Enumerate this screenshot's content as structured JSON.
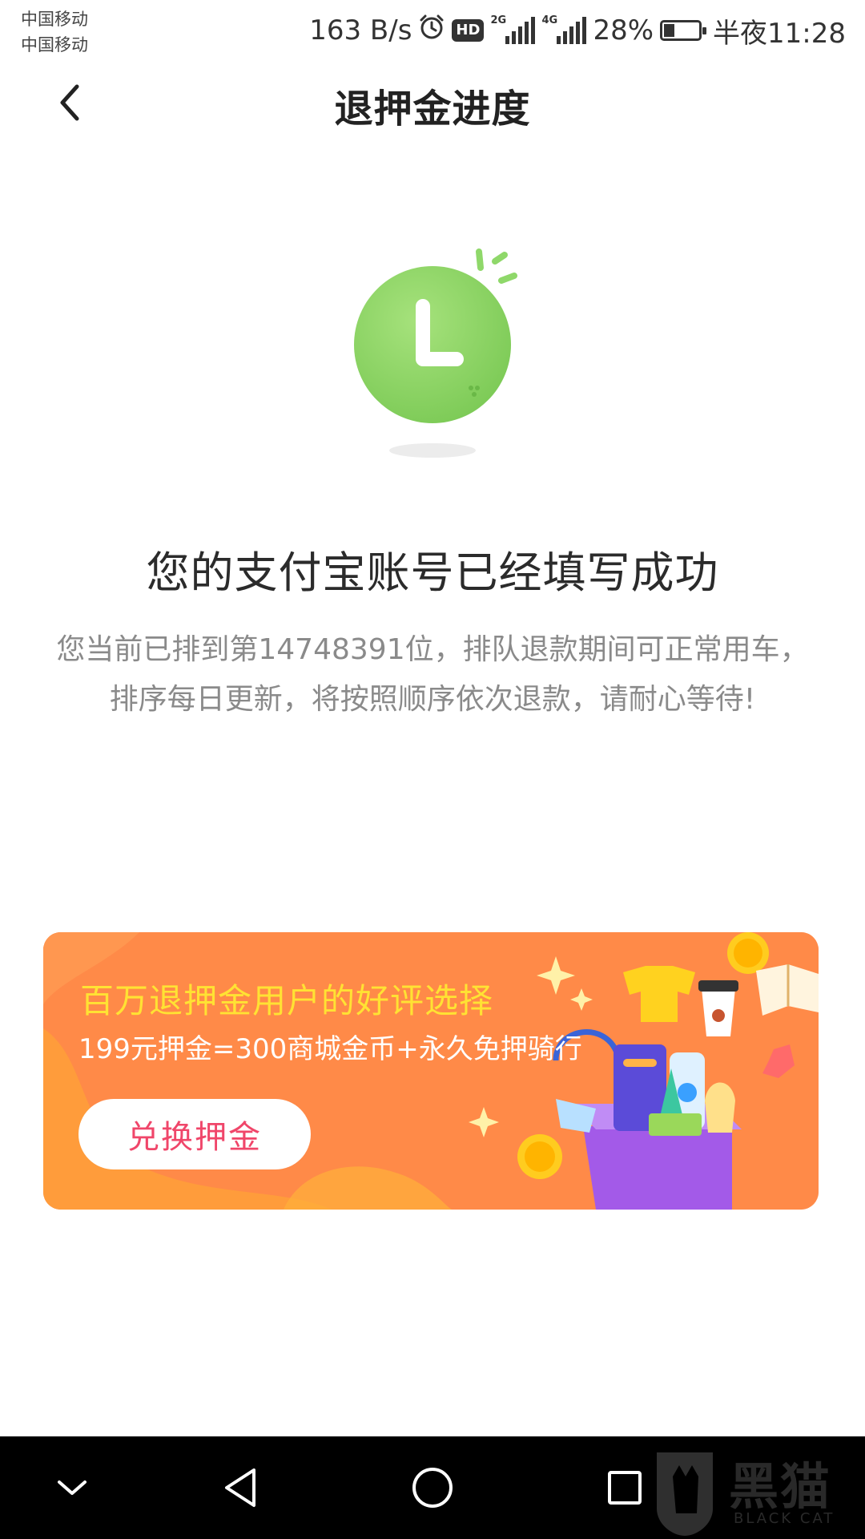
{
  "status_bar": {
    "carrier_1": "中国移动",
    "carrier_2": "中国移动",
    "net_speed": "163 B/s",
    "hd_badge": "HD",
    "signal_1_type": "2G",
    "signal_2_type": "4G",
    "battery": "28%",
    "time": "半夜11:28"
  },
  "header": {
    "title": "退押金进度"
  },
  "content": {
    "success_title": "您的支付宝账号已经填写成功",
    "queue_description": "您当前已排到第14748391位，排队退款期间可正常用车，排序每日更新，将按照顺序依次退款，请耐心等待!"
  },
  "promo_banner": {
    "title": "百万退押金用户的好评选择",
    "subtitle": "199元押金=300商城金币+永久免押骑行",
    "button_label": "兑换押金"
  },
  "watermark": {
    "text": "黑猫",
    "sub": "BLACK CAT"
  },
  "colors": {
    "clock_green": "#8fd86a",
    "banner_orange": "#ff8a48",
    "banner_title_yellow": "#ffe233",
    "button_text_pink": "#f0466a"
  }
}
